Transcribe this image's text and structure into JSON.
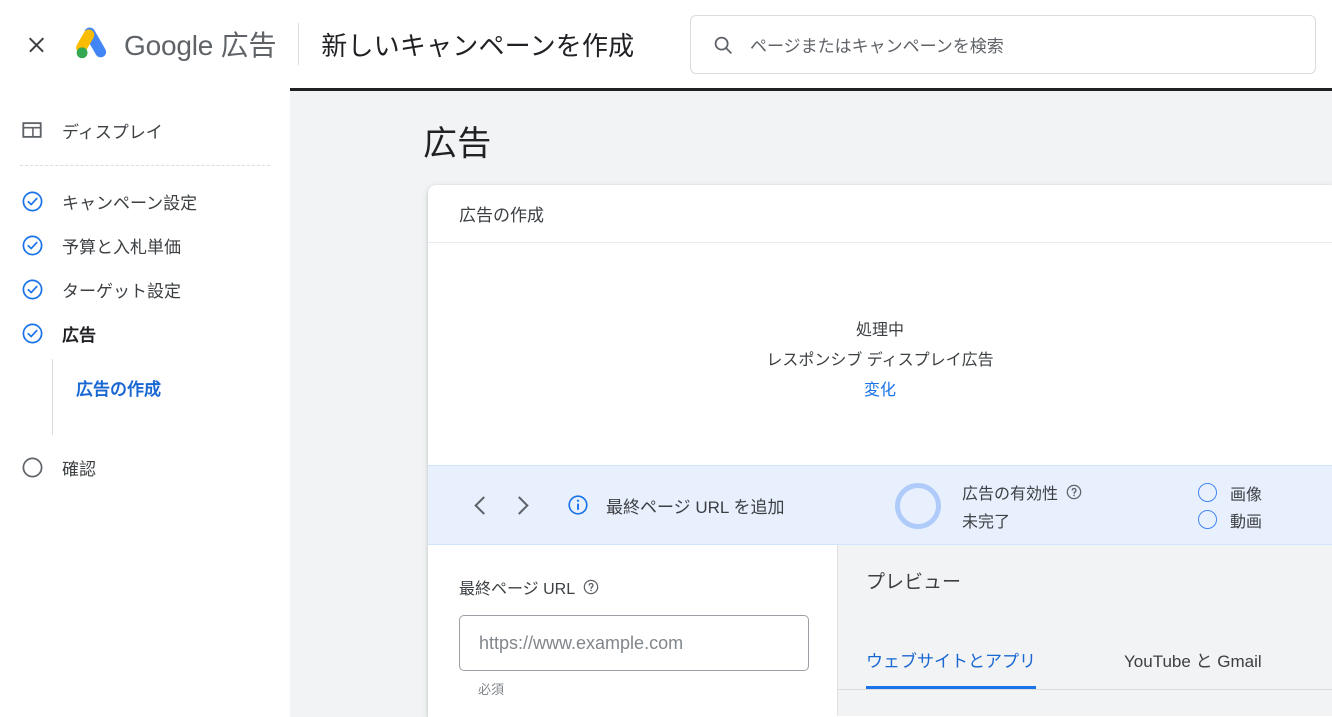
{
  "header": {
    "close_icon": "close-icon",
    "logo_icon": "google-ads-logo-icon",
    "brand": "Google 広告",
    "page_title": "新しいキャンペーンを作成",
    "search": {
      "icon": "search-icon",
      "placeholder": "ページまたはキャンペーンを検索",
      "value": ""
    }
  },
  "sidebar": {
    "items": [
      {
        "label": "ディスプレイ",
        "icon": "display-layout-icon",
        "state": "type"
      },
      {
        "label": "キャンペーン設定",
        "icon": "check-circle-icon",
        "state": "complete"
      },
      {
        "label": "予算と入札単価",
        "icon": "check-circle-icon",
        "state": "complete"
      },
      {
        "label": "ターゲット設定",
        "icon": "check-circle-icon",
        "state": "complete"
      },
      {
        "label": "広告",
        "icon": "check-circle-icon",
        "state": "current"
      },
      {
        "label": "確認",
        "icon": "empty-circle-icon",
        "state": "pending"
      }
    ],
    "sub_item": {
      "label": "広告の作成",
      "active": true
    }
  },
  "content": {
    "heading": "広告",
    "card": {
      "title": "広告の作成",
      "status": {
        "processing": "処理中",
        "ad_type": "レスポンシブ ディスプレイ広告",
        "change_link": "変化"
      },
      "toolbar": {
        "prev_icon": "chevron-left-icon",
        "next_icon": "chevron-right-icon",
        "info_icon": "info-circle-icon",
        "message": "最終ページ URL を追加",
        "effectiveness": {
          "ring_icon": "effectiveness-ring-icon",
          "label": "広告の有効性",
          "help_icon": "help-circle-icon",
          "value": "未完了"
        },
        "assets": [
          {
            "label": "画像",
            "icon": "empty-circle-icon"
          },
          {
            "label": "動画",
            "icon": "empty-circle-icon"
          }
        ]
      },
      "form": {
        "url_label": "最終ページ URL",
        "url_help_icon": "help-circle-icon",
        "url_placeholder": "https://www.example.com",
        "url_value": "",
        "required_note": "必須"
      },
      "preview": {
        "title": "プレビュー",
        "tabs": [
          {
            "label": "ウェブサイトとアプリ",
            "active": true
          },
          {
            "label": "YouTube と Gmail",
            "active": false
          }
        ]
      }
    }
  },
  "colors": {
    "brand_blue": "#4285f4",
    "link_blue": "#1a73e8",
    "active_blue": "#1967d2",
    "strip_bg": "#e8f0fe",
    "content_bg": "#f1f3f4",
    "text_primary": "#202124",
    "text_secondary": "#5f6368"
  }
}
